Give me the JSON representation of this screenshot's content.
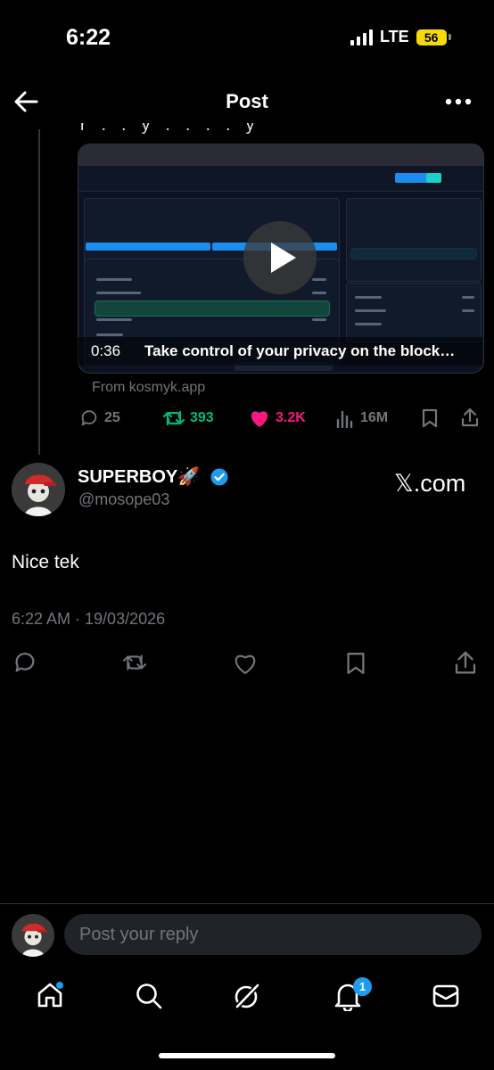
{
  "status_bar": {
    "time": "6:22",
    "network": "LTE",
    "battery": "56"
  },
  "header": {
    "title": "Post"
  },
  "quoted_post": {
    "video": {
      "duration": "0:36",
      "title": "Take control of your privacy on the block…"
    },
    "source": "From kosmyk.app",
    "stats": {
      "replies": "25",
      "reposts": "393",
      "likes": "3.2K",
      "views": "16M"
    }
  },
  "reply_post": {
    "display_name": "SUPERBOY🚀",
    "handle": "@mosope03",
    "watermark": "𝕏.com",
    "text": "Nice tek",
    "timestamp": "6:22 AM · 19/03/2026"
  },
  "composer": {
    "placeholder": "Post your reply"
  },
  "bottom_nav": {
    "notifications_badge": "1"
  },
  "colors": {
    "accent": "#1d9bf0",
    "repost": "#00ba7c",
    "like": "#f91880",
    "muted": "#71767b"
  }
}
